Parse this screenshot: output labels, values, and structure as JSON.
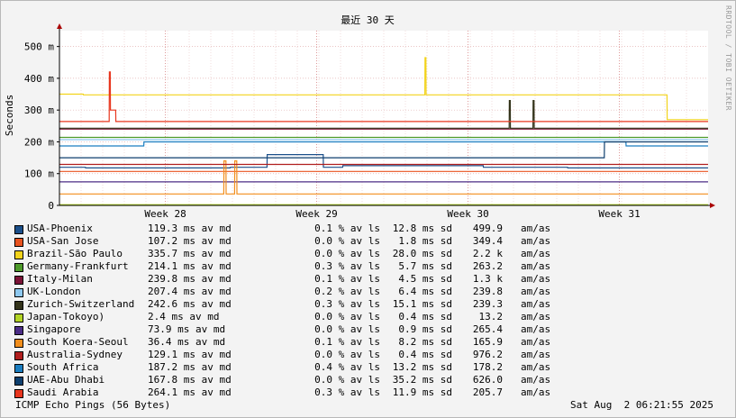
{
  "window": {
    "watermark": "RRDTOOL / TOBI OETIKER",
    "footer_left": "ICMP Echo Pings (56 Bytes)",
    "footer_right": "Sat Aug  2 06:21:55 2025"
  },
  "chart_data": {
    "type": "line",
    "title": "最近 30 天",
    "ylabel": "Seconds",
    "ylim": [
      0,
      0.55
    ],
    "yticks": [
      {
        "v": 0,
        "label": "0"
      },
      {
        "v": 0.1,
        "label": "100 m"
      },
      {
        "v": 0.2,
        "label": "200 m"
      },
      {
        "v": 0.3,
        "label": "300 m"
      },
      {
        "v": 0.4,
        "label": "400 m"
      },
      {
        "v": 0.5,
        "label": "500 m"
      }
    ],
    "xlim": [
      0,
      30
    ],
    "xticks": [
      {
        "v": 4.9,
        "label": "Week 28"
      },
      {
        "v": 11.9,
        "label": "Week 29"
      },
      {
        "v": 18.9,
        "label": "Week 30"
      },
      {
        "v": 25.9,
        "label": "Week 31"
      }
    ],
    "grid": true,
    "series": [
      {
        "name": "USA-Phoenix",
        "color": "#1b4f8a",
        "avg": "119.3 ms av md",
        "loss": "0.1 % av ls",
        "sd": "12.8 ms sd",
        "amas": "499.9",
        "amas_unit": "am/as",
        "x": [
          0,
          1.2,
          1.21,
          7.9,
          7.91,
          9.6,
          9.61,
          12.2,
          12.21,
          13.1,
          13.11,
          19.6,
          19.61,
          23.5,
          23.51,
          30
        ],
        "y": [
          0.12,
          0.12,
          0.118,
          0.118,
          0.12,
          0.12,
          0.16,
          0.16,
          0.12,
          0.12,
          0.125,
          0.125,
          0.12,
          0.12,
          0.118,
          0.118
        ]
      },
      {
        "name": "USA-San Jose",
        "color": "#e8531f",
        "avg": "107.2 ms av md",
        "loss": "0.0 % av ls",
        "sd": "1.8 ms sd",
        "amas": "349.4",
        "amas_unit": "am/as",
        "x": [
          0,
          30
        ],
        "y": [
          0.107,
          0.107
        ]
      },
      {
        "name": "Brazil-São Paulo",
        "color": "#f2d31b",
        "avg": "335.7 ms av md",
        "loss": "0.0 % av ls",
        "sd": "28.0 ms sd",
        "amas": "2.2 k",
        "amas_unit": "am/as",
        "x": [
          0,
          1.1,
          1.11,
          16.9,
          16.91,
          16.95,
          16.96,
          28.1,
          28.11,
          30
        ],
        "y": [
          0.35,
          0.35,
          0.348,
          0.348,
          0.465,
          0.465,
          0.348,
          0.348,
          0.27,
          0.27
        ]
      },
      {
        "name": "Germany-Frankfurt",
        "color": "#4d9a2a",
        "avg": "214.1 ms av md",
        "loss": "0.3 % av ls",
        "sd": "5.7 ms sd",
        "amas": "263.2",
        "amas_unit": "am/as",
        "x": [
          0,
          30
        ],
        "y": [
          0.214,
          0.214
        ]
      },
      {
        "name": "Italy-Milan",
        "color": "#7a1236",
        "avg": "239.8 ms av md",
        "loss": "0.1 % av ls",
        "sd": "4.5 ms sd",
        "amas": "1.3 k",
        "amas_unit": "am/as",
        "x": [
          0,
          30
        ],
        "y": [
          0.24,
          0.24
        ]
      },
      {
        "name": "UK-London",
        "color": "#8ec8ef",
        "avg": "207.4 ms av md",
        "loss": "0.2 % av ls",
        "sd": "6.4 ms sd",
        "amas": "239.8",
        "amas_unit": "am/as",
        "x": [
          0,
          30
        ],
        "y": [
          0.207,
          0.207
        ]
      },
      {
        "name": "Zurich-Switzerland",
        "color": "#33331a",
        "avg": "242.6 ms av md",
        "loss": "0.3 % av ls",
        "sd": "15.1 ms sd",
        "amas": "239.3",
        "amas_unit": "am/as",
        "x": [
          0,
          20.8,
          20.81,
          20.85,
          20.86,
          21.9,
          21.91,
          21.95,
          21.96,
          30
        ],
        "y": [
          0.243,
          0.243,
          0.33,
          0.33,
          0.243,
          0.243,
          0.33,
          0.33,
          0.243,
          0.243
        ]
      },
      {
        "name": "Japan-Tokoyo)",
        "color": "#b3d426",
        "avg": "2.4 ms av md",
        "loss": "0.0 % av ls",
        "sd": "0.4 ms sd",
        "amas": "13.2",
        "amas_unit": "am/as",
        "x": [
          0,
          30
        ],
        "y": [
          0.0024,
          0.0024
        ]
      },
      {
        "name": "Singapore",
        "color": "#4b2c86",
        "avg": "73.9 ms av md",
        "loss": "0.0 % av ls",
        "sd": "0.9 ms sd",
        "amas": "265.4",
        "amas_unit": "am/as",
        "x": [
          0,
          30
        ],
        "y": [
          0.074,
          0.074
        ]
      },
      {
        "name": "South Koera-Seoul",
        "color": "#f28e1c",
        "avg": "36.4 ms av md",
        "loss": "0.1 % av ls",
        "sd": "8.2 ms sd",
        "amas": "165.9",
        "amas_unit": "am/as",
        "x": [
          0,
          7.6,
          7.61,
          7.7,
          7.71,
          8.1,
          8.11,
          8.2,
          8.21,
          12.3,
          12.31,
          30
        ],
        "y": [
          0.036,
          0.036,
          0.14,
          0.14,
          0.036,
          0.036,
          0.14,
          0.14,
          0.036,
          0.036,
          0.036,
          0.036
        ]
      },
      {
        "name": "Australia-Sydney",
        "color": "#b01e1e",
        "avg": "129.1 ms av md",
        "loss": "0.0 % av ls",
        "sd": "0.4 ms sd",
        "amas": "976.2",
        "amas_unit": "am/as",
        "x": [
          0,
          30
        ],
        "y": [
          0.129,
          0.129
        ]
      },
      {
        "name": "South Africa",
        "color": "#1a7dc0",
        "avg": "187.2 ms av md",
        "loss": "0.4 % av ls",
        "sd": "13.2 ms sd",
        "amas": "178.2",
        "amas_unit": "am/as",
        "x": [
          0,
          3.9,
          3.91,
          26.2,
          26.21,
          30
        ],
        "y": [
          0.187,
          0.187,
          0.2,
          0.2,
          0.187,
          0.187
        ]
      },
      {
        "name": "UAE-Abu Dhabi",
        "color": "#0e3f6e",
        "avg": "167.8 ms av md",
        "loss": "0.0 % av ls",
        "sd": "35.2 ms sd",
        "amas": "626.0",
        "amas_unit": "am/as",
        "x": [
          0,
          25.2,
          25.21,
          30
        ],
        "y": [
          0.15,
          0.15,
          0.2,
          0.2
        ]
      },
      {
        "name": "Saudi Arabia",
        "color": "#e8361e",
        "avg": "264.1 ms av md",
        "loss": "0.3 % av ls",
        "sd": "11.9 ms sd",
        "amas": "205.7",
        "amas_unit": "am/as",
        "x": [
          0,
          2.3,
          2.31,
          2.35,
          2.36,
          2.6,
          2.61,
          30
        ],
        "y": [
          0.264,
          0.264,
          0.42,
          0.42,
          0.3,
          0.3,
          0.264,
          0.264
        ]
      }
    ]
  }
}
